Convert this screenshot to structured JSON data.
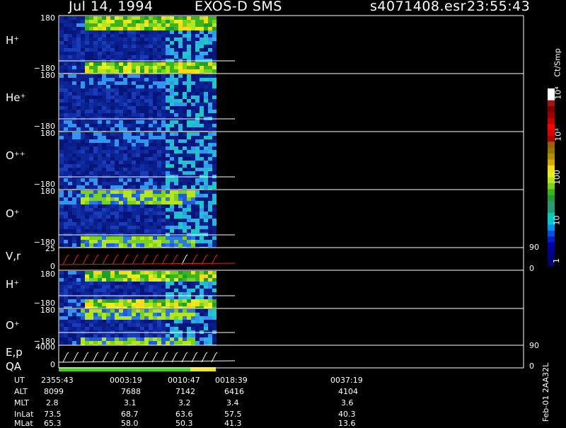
{
  "header": {
    "date": "Jul 14, 1994",
    "instrument": "EXOS-D SMS",
    "file": "s4071408.esr",
    "time": "23:55:43"
  },
  "colorbar": {
    "unit": "Ct/Smp",
    "labels": [
      "1",
      "10",
      "100",
      "10³",
      "10⁴"
    ],
    "colors": [
      "#00006a",
      "#00007d",
      "#000090",
      "#0000a8",
      "#001ec8",
      "#0050e6",
      "#0096f0",
      "#00c8d2",
      "#00cdb4",
      "#1e9e78",
      "#329678",
      "#1ea028",
      "#3cb41e",
      "#78d21e",
      "#b4e61e",
      "#e6ef1e",
      "#f5dc14",
      "#d2aa00",
      "#b48c00",
      "#967800",
      "#966400",
      "#b40000",
      "#dc0000",
      "#ff0000",
      "#c80000",
      "#a00000",
      "#800000",
      "#a01414",
      "#ffffff",
      "#ffffff"
    ]
  },
  "panels": [
    {
      "name": "H⁺",
      "top_tick": "180",
      "bottom_tick": "−180",
      "base": "#0a1e8a",
      "hot": 2
    },
    {
      "name": "He⁺",
      "top_tick": "180",
      "bottom_tick": "−180",
      "base": "#06188a",
      "hot": 0
    },
    {
      "name": "O⁺⁺",
      "top_tick": "180",
      "bottom_tick": "−180",
      "base": "#06188a",
      "hot": 0
    },
    {
      "name": "O⁺",
      "top_tick": "180",
      "bottom_tick": "−180",
      "base": "#06188a",
      "hot": 1
    },
    {
      "name": "V,r",
      "top_tick": "25",
      "bottom_tick": "0",
      "right_top": "90",
      "right_bottom": "0"
    },
    {
      "name": "H⁺",
      "top_tick": "180",
      "bottom_tick": "−180",
      "base": "#06188a",
      "hot": 2
    },
    {
      "name": "O⁺",
      "top_tick": "180",
      "bottom_tick": "−180",
      "base": "#06188a",
      "hot": 1
    },
    {
      "name": "E,p",
      "name2": "QA",
      "top_tick": "4000",
      "bottom_tick": "0",
      "right_top": "90",
      "right_bottom": "0"
    }
  ],
  "ephemeris": {
    "rows": [
      {
        "label": "UT",
        "values": [
          "2355:43",
          "0003:19",
          "0010:47",
          "0018:39",
          "0037:19"
        ]
      },
      {
        "label": "ALT",
        "values": [
          "8099",
          "7688",
          "7142",
          "6416",
          "4104"
        ]
      },
      {
        "label": "MLT",
        "values": [
          "2.8",
          "3.1",
          "3.2",
          "3.4",
          "3.6"
        ]
      },
      {
        "label": "InLat",
        "values": [
          "73.5",
          "68.7",
          "63.6",
          "57.5",
          "40.3"
        ]
      },
      {
        "label": "MLat",
        "values": [
          "65.3",
          "58.0",
          "50.3",
          "41.3",
          "13.6"
        ]
      }
    ]
  },
  "footer_id": "Feb-01 2AA32L"
}
